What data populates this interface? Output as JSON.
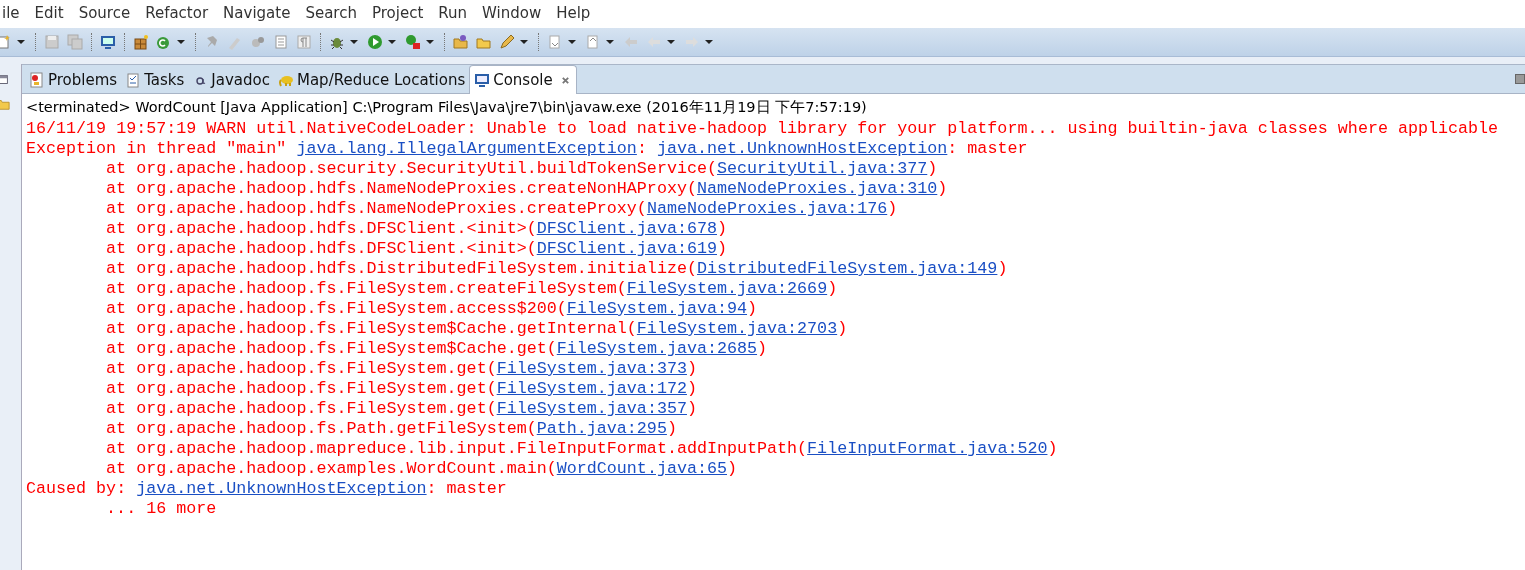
{
  "menu": [
    "ile",
    "Edit",
    "Source",
    "Refactor",
    "Navigate",
    "Search",
    "Project",
    "Run",
    "Window",
    "Help"
  ],
  "tabs": [
    {
      "label": "Problems",
      "selected": false
    },
    {
      "label": "Tasks",
      "selected": false
    },
    {
      "label": "Javadoc",
      "selected": false
    },
    {
      "label": "Map/Reduce Locations",
      "selected": false
    },
    {
      "label": "Console",
      "selected": true
    }
  ],
  "console": {
    "header": "<terminated> WordCount [Java Application] C:\\Program Files\\Java\\jre7\\bin\\javaw.exe (2016年11月19日 下午7:57:19)",
    "lines": [
      {
        "kind": "plain",
        "parts": [
          {
            "text": "16/11/19 19:57:19 WARN util.NativeCodeLoader: Unable to load native-hadoop library for your platform... using builtin-java classes where applicable",
            "kind": "text"
          }
        ]
      },
      {
        "kind": "plain",
        "parts": [
          {
            "text": "Exception in thread \"main\" ",
            "kind": "text"
          },
          {
            "text": "java.lang.IllegalArgumentException",
            "kind": "link"
          },
          {
            "text": ": ",
            "kind": "text"
          },
          {
            "text": "java.net.UnknownHostException",
            "kind": "link"
          },
          {
            "text": ": master",
            "kind": "text"
          }
        ]
      },
      {
        "kind": "frame",
        "parts": [
          {
            "text": "at org.apache.hadoop.security.SecurityUtil.buildTokenService(",
            "kind": "text"
          },
          {
            "text": "SecurityUtil.java:377",
            "kind": "link"
          },
          {
            "text": ")",
            "kind": "text"
          }
        ]
      },
      {
        "kind": "frame",
        "parts": [
          {
            "text": "at org.apache.hadoop.hdfs.NameNodeProxies.createNonHAProxy(",
            "kind": "text"
          },
          {
            "text": "NameNodeProxies.java:310",
            "kind": "link"
          },
          {
            "text": ")",
            "kind": "text"
          }
        ]
      },
      {
        "kind": "frame",
        "parts": [
          {
            "text": "at org.apache.hadoop.hdfs.NameNodeProxies.createProxy(",
            "kind": "text"
          },
          {
            "text": "NameNodeProxies.java:176",
            "kind": "link"
          },
          {
            "text": ")",
            "kind": "text"
          }
        ]
      },
      {
        "kind": "frame",
        "parts": [
          {
            "text": "at org.apache.hadoop.hdfs.DFSClient.<init>(",
            "kind": "text"
          },
          {
            "text": "DFSClient.java:678",
            "kind": "link"
          },
          {
            "text": ")",
            "kind": "text"
          }
        ]
      },
      {
        "kind": "frame",
        "parts": [
          {
            "text": "at org.apache.hadoop.hdfs.DFSClient.<init>(",
            "kind": "text"
          },
          {
            "text": "DFSClient.java:619",
            "kind": "link"
          },
          {
            "text": ")",
            "kind": "text"
          }
        ]
      },
      {
        "kind": "frame",
        "parts": [
          {
            "text": "at org.apache.hadoop.hdfs.DistributedFileSystem.initialize(",
            "kind": "text"
          },
          {
            "text": "DistributedFileSystem.java:149",
            "kind": "link"
          },
          {
            "text": ")",
            "kind": "text"
          }
        ]
      },
      {
        "kind": "frame",
        "parts": [
          {
            "text": "at org.apache.hadoop.fs.FileSystem.createFileSystem(",
            "kind": "text"
          },
          {
            "text": "FileSystem.java:2669",
            "kind": "link"
          },
          {
            "text": ")",
            "kind": "text"
          }
        ]
      },
      {
        "kind": "frame",
        "parts": [
          {
            "text": "at org.apache.hadoop.fs.FileSystem.access$200(",
            "kind": "text"
          },
          {
            "text": "FileSystem.java:94",
            "kind": "link"
          },
          {
            "text": ")",
            "kind": "text"
          }
        ]
      },
      {
        "kind": "frame",
        "parts": [
          {
            "text": "at org.apache.hadoop.fs.FileSystem$Cache.getInternal(",
            "kind": "text"
          },
          {
            "text": "FileSystem.java:2703",
            "kind": "link"
          },
          {
            "text": ")",
            "kind": "text"
          }
        ]
      },
      {
        "kind": "frame",
        "parts": [
          {
            "text": "at org.apache.hadoop.fs.FileSystem$Cache.get(",
            "kind": "text"
          },
          {
            "text": "FileSystem.java:2685",
            "kind": "link"
          },
          {
            "text": ")",
            "kind": "text"
          }
        ]
      },
      {
        "kind": "frame",
        "parts": [
          {
            "text": "at org.apache.hadoop.fs.FileSystem.get(",
            "kind": "text"
          },
          {
            "text": "FileSystem.java:373",
            "kind": "link"
          },
          {
            "text": ")",
            "kind": "text"
          }
        ]
      },
      {
        "kind": "frame",
        "parts": [
          {
            "text": "at org.apache.hadoop.fs.FileSystem.get(",
            "kind": "text"
          },
          {
            "text": "FileSystem.java:172",
            "kind": "link"
          },
          {
            "text": ")",
            "kind": "text"
          }
        ]
      },
      {
        "kind": "frame",
        "parts": [
          {
            "text": "at org.apache.hadoop.fs.FileSystem.get(",
            "kind": "text"
          },
          {
            "text": "FileSystem.java:357",
            "kind": "link"
          },
          {
            "text": ")",
            "kind": "text"
          }
        ]
      },
      {
        "kind": "frame",
        "parts": [
          {
            "text": "at org.apache.hadoop.fs.Path.getFileSystem(",
            "kind": "text"
          },
          {
            "text": "Path.java:295",
            "kind": "link"
          },
          {
            "text": ")",
            "kind": "text"
          }
        ]
      },
      {
        "kind": "frame",
        "parts": [
          {
            "text": "at org.apache.hadoop.mapreduce.lib.input.FileInputFormat.addInputPath(",
            "kind": "text"
          },
          {
            "text": "FileInputFormat.java:520",
            "kind": "link"
          },
          {
            "text": ")",
            "kind": "text"
          }
        ]
      },
      {
        "kind": "frame",
        "parts": [
          {
            "text": "at org.apache.hadoop.examples.WordCount.main(",
            "kind": "text"
          },
          {
            "text": "WordCount.java:65",
            "kind": "link"
          },
          {
            "text": ")",
            "kind": "text"
          }
        ]
      },
      {
        "kind": "plain",
        "parts": [
          {
            "text": "Caused by: ",
            "kind": "text"
          },
          {
            "text": "java.net.UnknownHostException",
            "kind": "link"
          },
          {
            "text": ": master",
            "kind": "text"
          }
        ]
      },
      {
        "kind": "frame",
        "parts": [
          {
            "text": "... 16 more",
            "kind": "text"
          }
        ]
      }
    ]
  }
}
